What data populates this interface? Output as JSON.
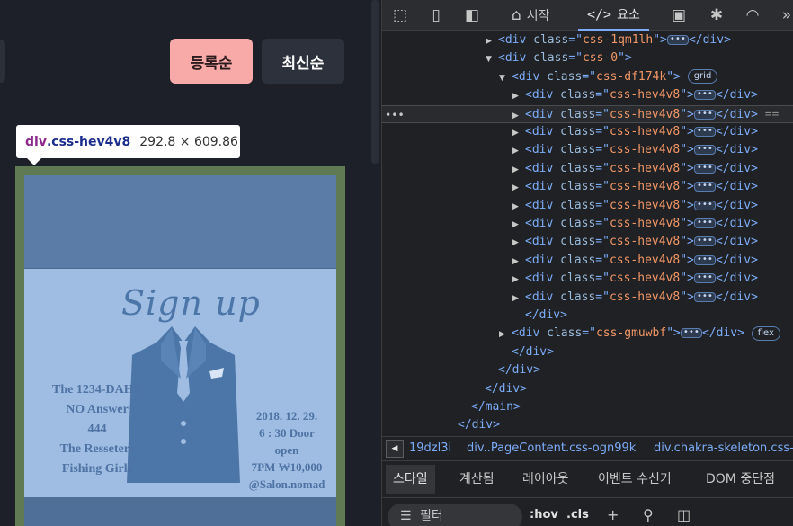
{
  "page": {
    "sort_buttons": [
      {
        "label": "등록순",
        "bg": "#f8aaa8"
      },
      {
        "label": "최신순",
        "bg": "#2c313c"
      }
    ],
    "tooltip": {
      "tag": "div",
      "class": ".css-hev4v8",
      "size": "292.8 × 609.86"
    },
    "poster": {
      "title": "Sign up",
      "lineup": [
        "The 1234-DAH!!",
        "NO Answer",
        "444",
        "The Resseters",
        "Fishing Girls"
      ],
      "event_info": [
        "2018.  12.  29.",
        "6 : 30 Door open",
        "7PM  ₩10,000",
        "@Salon.nomad"
      ]
    }
  },
  "devtools": {
    "toolbar": {
      "tabs": [
        {
          "icon": "house-icon",
          "label": "시작"
        },
        {
          "icon": "code-icon",
          "label": "요소"
        }
      ]
    },
    "dom_lines": [
      {
        "indent": 7,
        "tri": "▶",
        "cls": "css-1qm1lh",
        "collapsed": true,
        "close": "</div>"
      },
      {
        "indent": 7,
        "tri": "▼",
        "cls": "css-0",
        "collapsed": false,
        "close": ""
      },
      {
        "indent": 8,
        "tri": "▼",
        "cls": "css-df174k",
        "collapsed": false,
        "close": "",
        "badge": "grid"
      },
      {
        "indent": 9,
        "tri": "▶",
        "cls": "css-hev4v8",
        "collapsed": true,
        "close": "</div>"
      },
      {
        "indent": 9,
        "tri": "▶",
        "cls": "css-hev4v8",
        "collapsed": true,
        "close": "</div>",
        "hover": true,
        "suffix": "=="
      },
      {
        "indent": 9,
        "tri": "▶",
        "cls": "css-hev4v8",
        "collapsed": true,
        "close": "</div>"
      },
      {
        "indent": 9,
        "tri": "▶",
        "cls": "css-hev4v8",
        "collapsed": true,
        "close": "</div>"
      },
      {
        "indent": 9,
        "tri": "▶",
        "cls": "css-hev4v8",
        "collapsed": true,
        "close": "</div>"
      },
      {
        "indent": 9,
        "tri": "▶",
        "cls": "css-hev4v8",
        "collapsed": true,
        "close": "</div>"
      },
      {
        "indent": 9,
        "tri": "▶",
        "cls": "css-hev4v8",
        "collapsed": true,
        "close": "</div>"
      },
      {
        "indent": 9,
        "tri": "▶",
        "cls": "css-hev4v8",
        "collapsed": true,
        "close": "</div>"
      },
      {
        "indent": 9,
        "tri": "▶",
        "cls": "css-hev4v8",
        "collapsed": true,
        "close": "</div>"
      },
      {
        "indent": 9,
        "tri": "▶",
        "cls": "css-hev4v8",
        "collapsed": true,
        "close": "</div>"
      },
      {
        "indent": 9,
        "tri": "▶",
        "cls": "css-hev4v8",
        "collapsed": true,
        "close": "</div>"
      },
      {
        "indent": 9,
        "tri": "▶",
        "cls": "css-hev4v8",
        "collapsed": true,
        "close": "</div>"
      },
      {
        "indent": 9,
        "closing": "</div>"
      },
      {
        "indent": 8,
        "tri": "▶",
        "cls": "css-gmuwbf",
        "collapsed": true,
        "close": "</div>",
        "badge": "flex"
      },
      {
        "indent": 8,
        "closing": "</div>"
      },
      {
        "indent": 7,
        "closing": "</div>"
      },
      {
        "indent": 6,
        "closing": "</div>"
      },
      {
        "indent": 5,
        "closing": "</main>"
      },
      {
        "indent": 4,
        "closing": "</div>"
      }
    ],
    "breadcrumbs": [
      "19dzl3i",
      "div..PageContent.css-ogn99k",
      "div.chakra-skeleton.css-"
    ],
    "style_tabs": [
      "스타일",
      "계산됨",
      "레이아웃",
      "이벤트 수신기",
      "DOM 중단점"
    ],
    "filter": {
      "placeholder": "필터",
      "hov": ":hov",
      "cls": ".cls"
    }
  }
}
